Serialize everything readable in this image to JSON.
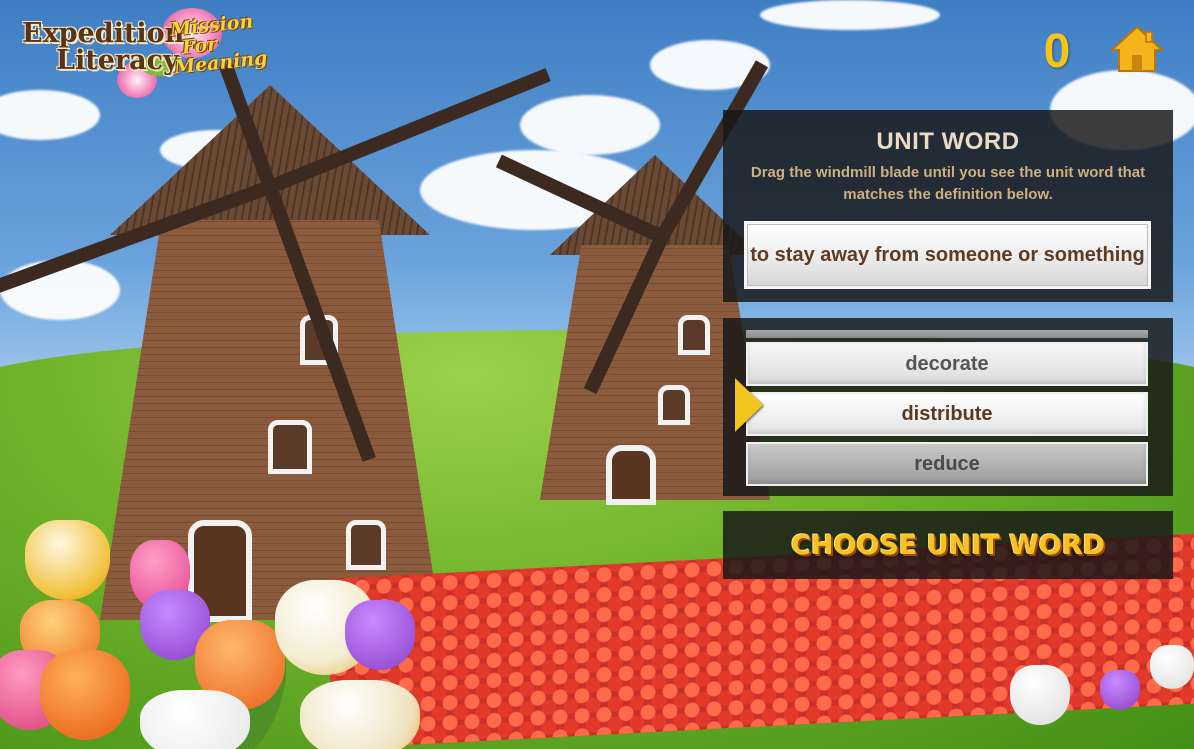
{
  "logo": {
    "line1": "Expedition",
    "line2": "Literacy",
    "sub1": "Mission",
    "sub2": "For",
    "sub3": "Meaning"
  },
  "hud": {
    "score": "0",
    "home_icon": "home-icon"
  },
  "definition_panel": {
    "title": "UNIT WORD",
    "instructions": "Drag the windmill blade until you see the unit word that matches the definition below.",
    "definition": "to stay away from someone or something"
  },
  "word_wheel": {
    "pointer_icon": "triangle-pointer-icon",
    "options": [
      "decorate",
      "distribute",
      "reduce"
    ],
    "selected_option": "distribute"
  },
  "choose_button": {
    "label": "CHOOSE UNIT WORD"
  },
  "colors": {
    "accent_gold": "#f4c418",
    "panel_bg": "#181818",
    "title_text": "#e9dbc6",
    "instruction_text": "#cfae80",
    "definition_text": "#5f3b21"
  }
}
